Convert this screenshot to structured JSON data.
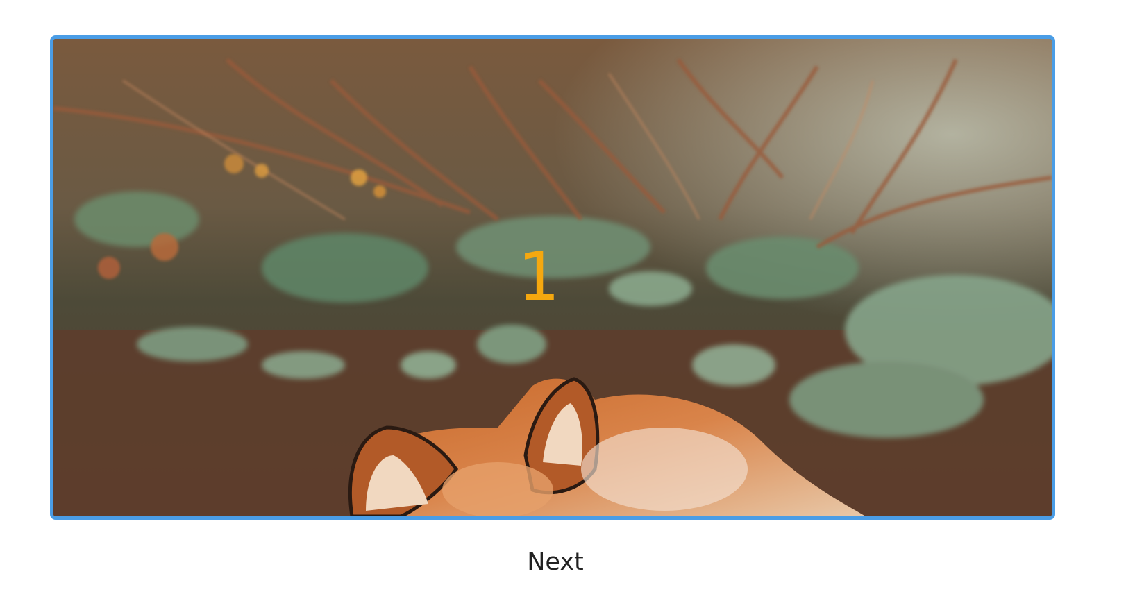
{
  "carousel": {
    "slide_number": "1",
    "next_label": "Next",
    "slide_image": "fox-in-forest-photo"
  },
  "colors": {
    "frame_border": "#4a9de6",
    "slide_number": "#f5a80f",
    "button_text": "#222222"
  }
}
